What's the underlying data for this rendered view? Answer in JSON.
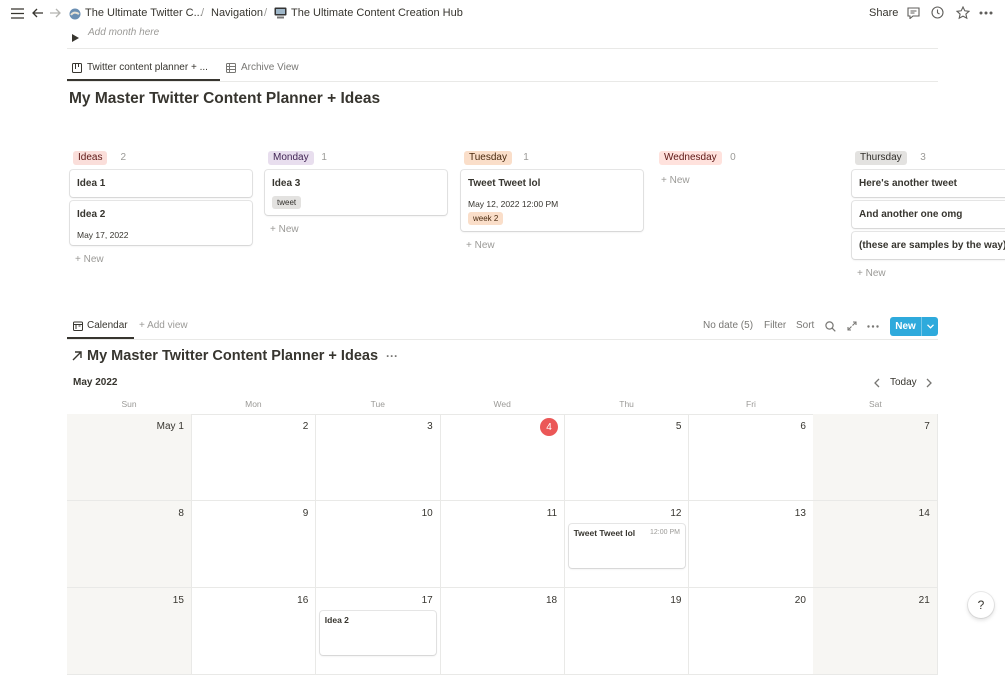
{
  "topbar": {
    "breadcrumbs": [
      {
        "label": "The Ultimate Twitter C..."
      },
      {
        "label": "Navigation"
      },
      {
        "label": "The Ultimate Content Creation Hub"
      }
    ],
    "share_label": "Share"
  },
  "add_month_label": "Add month here",
  "tabs": [
    {
      "label": "Twitter content planner + ...",
      "active": true,
      "icon": "board-icon"
    },
    {
      "label": "Archive View",
      "active": false,
      "icon": "table-icon"
    }
  ],
  "board": {
    "title": "My Master Twitter Content Planner + Ideas",
    "new_label": "New",
    "groups": [
      {
        "name": "Ideas",
        "count": "2",
        "bg": "#fadeda",
        "fg": "#5d1715",
        "cards": [
          {
            "title": "Idea 1"
          },
          {
            "title": "Idea 2",
            "date": "May 17, 2022"
          }
        ]
      },
      {
        "name": "Monday",
        "count": "1",
        "bg": "#e8deee",
        "fg": "#412454",
        "cards": [
          {
            "title": "Idea 3",
            "tag": "tweet"
          }
        ]
      },
      {
        "name": "Tuesday",
        "count": "1",
        "bg": "#fadec9",
        "fg": "#49290e",
        "cards": [
          {
            "title": "Tweet Tweet lol",
            "date": "May 12, 2022 12:00 PM",
            "tag": "week 2"
          }
        ]
      },
      {
        "name": "Wednesday",
        "count": "0",
        "bg": "#ffe2dd",
        "fg": "#5d1715",
        "cards": []
      },
      {
        "name": "Thursday",
        "count": "3",
        "bg": "#e3e2e0",
        "fg": "#32302c",
        "cards": [
          {
            "title": "Here's another tweet"
          },
          {
            "title": "And another one omg"
          },
          {
            "title": "(these are samples by the way)"
          }
        ]
      }
    ]
  },
  "calendar_view": {
    "tab_label": "Calendar",
    "add_view_label": "Add view",
    "no_date_label": "No date (5)",
    "filter_label": "Filter",
    "sort_label": "Sort",
    "new_button_label": "New",
    "accent_color": "#2eaadc",
    "linked_title": "My Master Twitter Content Planner + Ideas",
    "month_label": "May 2022",
    "today_label": "Today",
    "weekdays": [
      "Sun",
      "Mon",
      "Tue",
      "Wed",
      "Thu",
      "Fri",
      "Sat"
    ],
    "weeks": [
      [
        "May 1",
        "2",
        "3",
        "4",
        "5",
        "6",
        "7"
      ],
      [
        "8",
        "9",
        "10",
        "11",
        "12",
        "13",
        "14"
      ],
      [
        "15",
        "16",
        "17",
        "18",
        "19",
        "20",
        "21"
      ]
    ],
    "today_day": "4",
    "events": [
      {
        "week": 1,
        "day": 4,
        "title": "Tweet Tweet lol",
        "time": "12:00 PM"
      },
      {
        "week": 2,
        "day": 2,
        "title": "Idea 2",
        "time": ""
      }
    ]
  },
  "help_label": "?"
}
